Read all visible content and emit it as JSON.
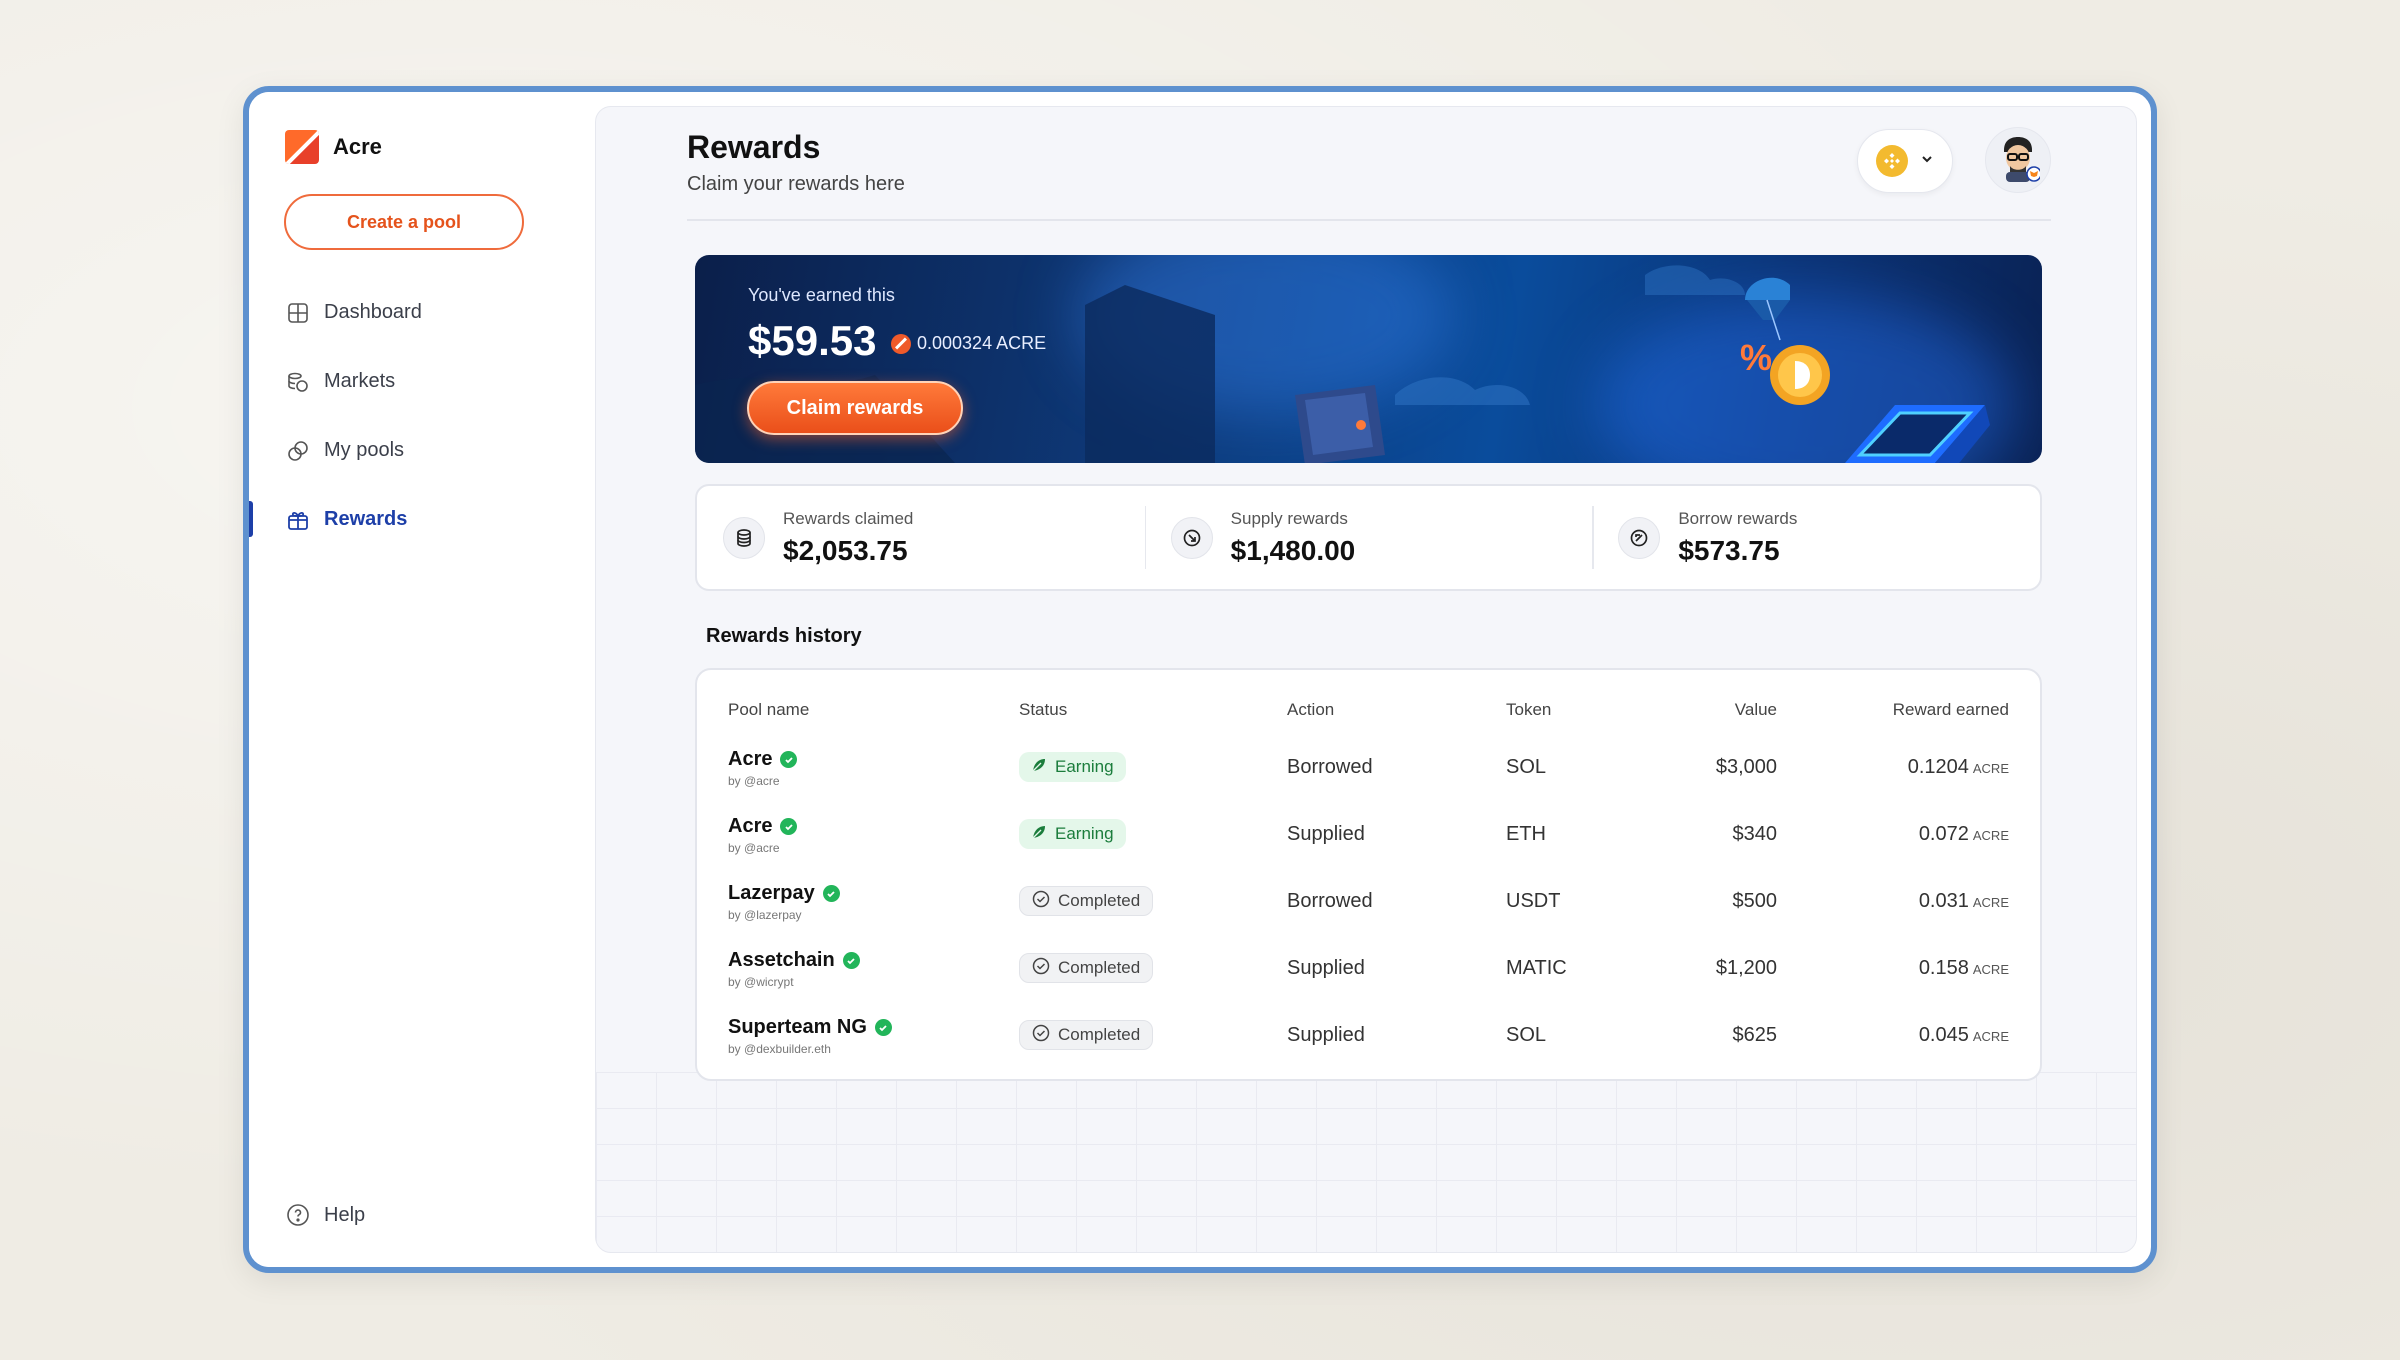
{
  "brand": {
    "name": "Acre"
  },
  "sidebar": {
    "create_label": "Create a pool",
    "items": [
      {
        "label": "Dashboard",
        "icon": "grid-icon"
      },
      {
        "label": "Markets",
        "icon": "coins-icon"
      },
      {
        "label": "My pools",
        "icon": "pools-icon"
      },
      {
        "label": "Rewards",
        "icon": "gift-icon",
        "active": true
      }
    ],
    "help_label": "Help"
  },
  "header": {
    "title": "Rewards",
    "subtitle": "Claim your rewards here",
    "chain_icon": "bnb-icon",
    "avatar_icon": "user-avatar-icon"
  },
  "banner": {
    "label": "You've earned this",
    "value": "$59.53",
    "acre_amount": "0.000324 ACRE",
    "claim_label": "Claim rewards"
  },
  "stats": [
    {
      "label": "Rewards claimed",
      "value": "$2,053.75",
      "icon": "database-icon"
    },
    {
      "label": "Supply rewards",
      "value": "$1,480.00",
      "icon": "supply-icon"
    },
    {
      "label": "Borrow rewards",
      "value": "$573.75",
      "icon": "borrow-icon"
    }
  ],
  "history": {
    "title": "Rewards history",
    "columns": [
      "Pool name",
      "Status",
      "Action",
      "Token",
      "Value",
      "Reward earned"
    ],
    "rows": [
      {
        "pool": "Acre",
        "by": "by @acre",
        "status": "Earning",
        "action": "Borrowed",
        "token": "SOL",
        "value": "$3,000",
        "reward": "0.1204",
        "unit": "ACRE"
      },
      {
        "pool": "Acre",
        "by": "by @acre",
        "status": "Earning",
        "action": "Supplied",
        "token": "ETH",
        "value": "$340",
        "reward": "0.072",
        "unit": "ACRE"
      },
      {
        "pool": "Lazerpay",
        "by": "by @lazerpay",
        "status": "Completed",
        "action": "Borrowed",
        "token": "USDT",
        "value": "$500",
        "reward": "0.031",
        "unit": "ACRE"
      },
      {
        "pool": "Assetchain",
        "by": "by @wicrypt",
        "status": "Completed",
        "action": "Supplied",
        "token": "MATIC",
        "value": "$1,200",
        "reward": "0.158",
        "unit": "ACRE"
      },
      {
        "pool": "Superteam NG",
        "by": "by @dexbuilder.eth",
        "status": "Completed",
        "action": "Supplied",
        "token": "SOL",
        "value": "$625",
        "reward": "0.045",
        "unit": "ACRE"
      }
    ]
  },
  "colors": {
    "accent": "#1d3fa8",
    "brand": "#ef5a2a",
    "frame": "#5e91cf",
    "earning": "#22b55a"
  }
}
